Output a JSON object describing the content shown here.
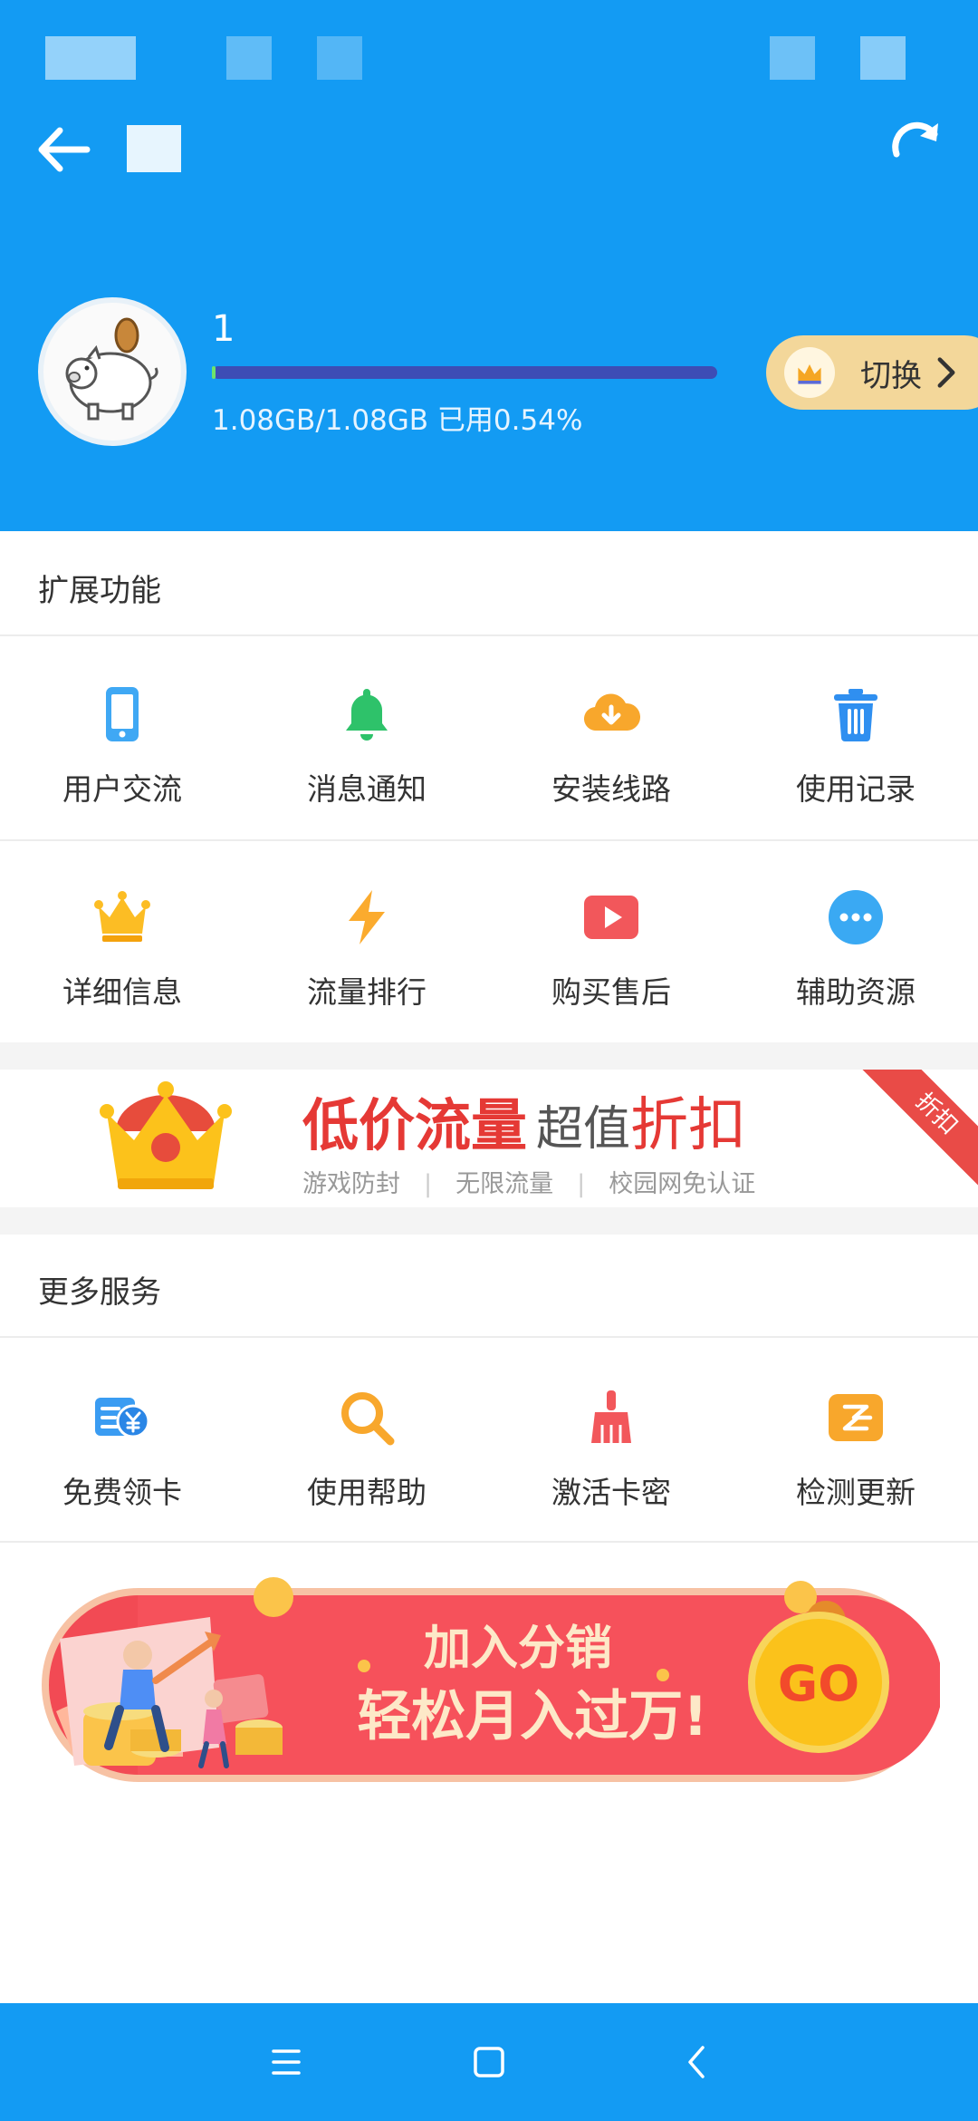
{
  "colors": {
    "primary": "#139bf3",
    "switch_bg": "#f3d79a",
    "progress_fill": "#6fe36a",
    "progress_track": "#3d4db5"
  },
  "header": {
    "back_icon": "arrow-left-icon",
    "refresh_icon": "refresh-icon"
  },
  "profile": {
    "name": "1",
    "quota_text": "1.08GB/1.08GB 已用0.54%",
    "used_fraction": 0.0054,
    "avatar_icon": "piggy-bank-icon",
    "switch_label": "切换",
    "switch_icon": "crown-icon"
  },
  "extended": {
    "title": "扩展功能",
    "items": [
      {
        "label": "用户交流",
        "icon": "phone-icon"
      },
      {
        "label": "消息通知",
        "icon": "bell-icon"
      },
      {
        "label": "安装线路",
        "icon": "cloud-download-icon"
      },
      {
        "label": "使用记录",
        "icon": "trash-icon"
      },
      {
        "label": "详细信息",
        "icon": "crown-icon"
      },
      {
        "label": "流量排行",
        "icon": "lightning-icon"
      },
      {
        "label": "购买售后",
        "icon": "play-icon"
      },
      {
        "label": "辅助资源",
        "icon": "more-dots-icon"
      }
    ]
  },
  "promo": {
    "title_red": "低价流量",
    "title_mid": "超值",
    "title_big": "折扣",
    "tags": [
      "游戏防封",
      "无限流量",
      "校园网免认证"
    ],
    "ribbon": "折扣"
  },
  "more": {
    "title": "更多服务",
    "items": [
      {
        "label": "免费领卡",
        "icon": "card-yen-icon"
      },
      {
        "label": "使用帮助",
        "icon": "search-icon"
      },
      {
        "label": "激活卡密",
        "icon": "broom-icon"
      },
      {
        "label": "检测更新",
        "icon": "update-box-icon"
      }
    ]
  },
  "distribution": {
    "line1": "加入分销",
    "line2": "轻松月入过万!",
    "go": "GO"
  },
  "system_nav": {
    "menu_icon": "menu-icon",
    "home_icon": "home-square-icon",
    "back_icon": "back-chevron-icon"
  }
}
